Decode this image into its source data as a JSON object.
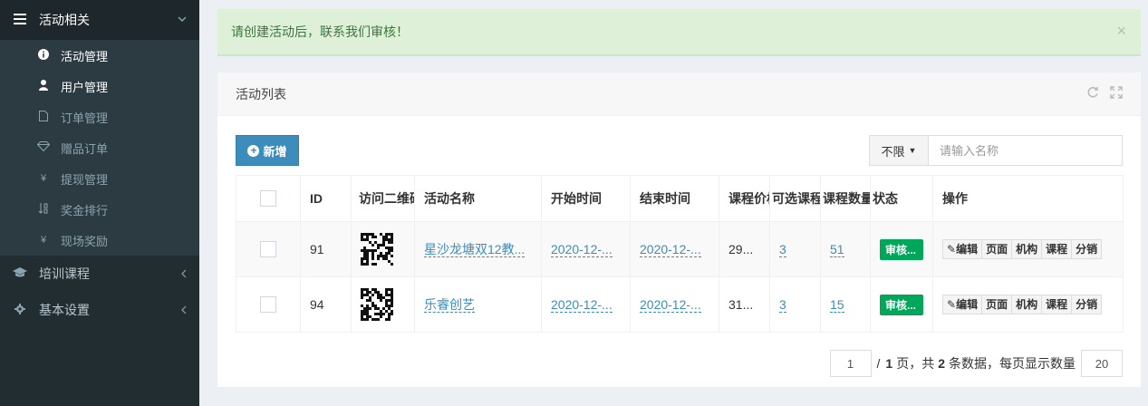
{
  "sidebar": {
    "group": {
      "label": "活动相关",
      "icon": "menu-icon"
    },
    "items": [
      {
        "label": "活动管理",
        "icon": "info-circle-icon",
        "active": true
      },
      {
        "label": "用户管理",
        "icon": "user-icon",
        "active": true
      },
      {
        "label": "订单管理",
        "icon": "file-icon",
        "active": false
      },
      {
        "label": "赠品订单",
        "icon": "diamond-icon",
        "active": false
      },
      {
        "label": "提现管理",
        "icon": "yen-icon",
        "active": false
      },
      {
        "label": "奖金排行",
        "icon": "sort-icon",
        "active": false
      },
      {
        "label": "现场奖励",
        "icon": "yen-icon",
        "active": false
      }
    ],
    "top_items": [
      {
        "label": "培训课程",
        "icon": "graduation-cap-icon"
      },
      {
        "label": "基本设置",
        "icon": "gear-icon"
      }
    ]
  },
  "alert": {
    "text": "请创建活动后，联系我们审核！",
    "close": "×"
  },
  "box": {
    "title": "活动列表",
    "new_button": "新增",
    "filter_dropdown": "不限",
    "search_placeholder": "请输入名称"
  },
  "table": {
    "headers": [
      "",
      "ID",
      "访问二维码",
      "活动名称",
      "开始时间",
      "结束时间",
      "课程价格",
      "可选课程数",
      "课程数量",
      "状态",
      "操作"
    ],
    "rows": [
      {
        "id": "91",
        "name": "星沙龙塘双12教...",
        "start": "2020-12-...",
        "end": "2020-12-...",
        "price": "29...",
        "optional": "3",
        "count": "51",
        "status": "审核..."
      },
      {
        "id": "94",
        "name": "乐睿创艺",
        "start": "2020-12-...",
        "end": "2020-12-...",
        "price": "31...",
        "optional": "3",
        "count": "15",
        "status": "审核..."
      }
    ],
    "ops": [
      "编辑",
      "页面",
      "机构",
      "课程",
      "分销"
    ]
  },
  "pager": {
    "page": "1",
    "total_pages_prefix": "/",
    "total_pages": "1",
    "total_pages_suffix": "页，共",
    "total_count": "2",
    "total_count_suffix": "条数据，每页显示数量",
    "page_size": "20"
  }
}
